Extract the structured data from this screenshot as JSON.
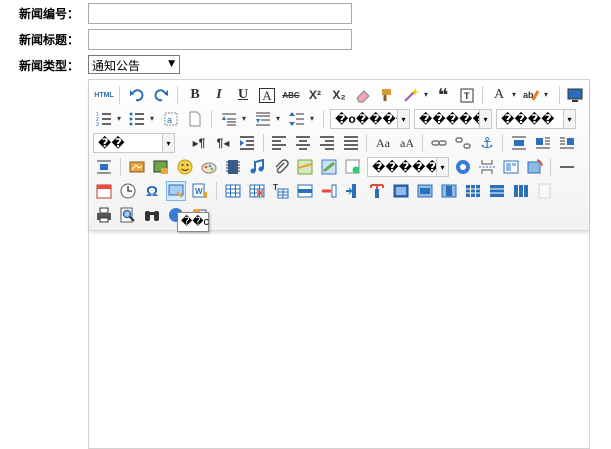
{
  "form": {
    "id_label": "新闻编号：",
    "id_value": "",
    "title_label": "新闻标题：",
    "title_value": "",
    "type_label": "新闻类型：",
    "type_value": "通知公告"
  },
  "toolbar": {
    "row1": {
      "source": "HTML",
      "bold": "B",
      "italic": "I",
      "underline": "U",
      "fontborder": "A",
      "strike": "ABC",
      "superscript": "X²",
      "subscript": "X₂",
      "forecolor": "A"
    },
    "row2": {
      "paragraph": "�o����",
      "fontfamily": "�����",
      "fontsize": "����"
    },
    "row3": {
      "customstyle": "��",
      "insertframe": "�����"
    },
    "tooltip": "��c"
  },
  "colors": {
    "border": "#d4d4d4",
    "hover_border": "#7db3e6",
    "hover_bg": "#d9ecfb",
    "icon_blue": "#2a6fb7"
  }
}
